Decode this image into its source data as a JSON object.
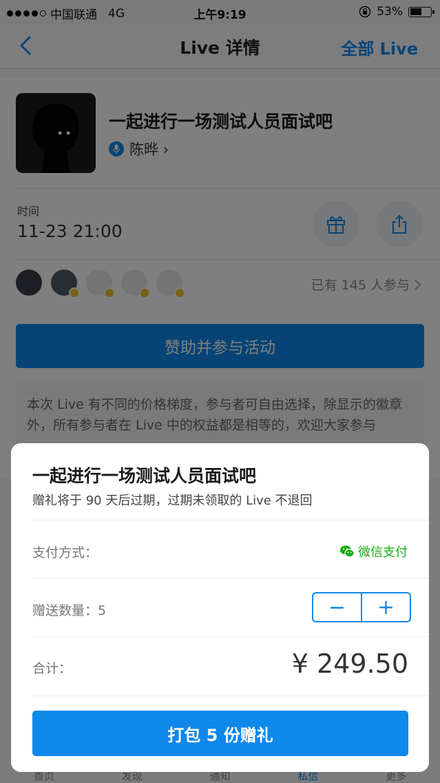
{
  "status_bar": {
    "carrier": "中国联通",
    "network": "4G",
    "time": "上午9:19",
    "battery": "53%"
  },
  "nav": {
    "title": "Live 详情",
    "right_link": "全部 Live",
    "back_icon": "chevron-left-icon"
  },
  "live": {
    "title": "一起进行一场测试人员面试吧",
    "speaker": "陈晔 ›",
    "time_label": "时间",
    "time_value": "11-23 21:00",
    "participants": "已有 145 人参与",
    "sponsor_button": "赞助并参与活动",
    "note": "本次 Live 有不同的价格梯度，参与者可自由选择，除显示的徽章外，所有参与者在 Live 中的权益都是相等的，欢迎大家参与"
  },
  "tabbar": {
    "items": [
      "首页",
      "发现",
      "通知",
      "私信",
      "更多"
    ]
  },
  "gift_modal": {
    "title": "一起进行一场测试人员面试吧",
    "subtitle": "赠礼将于 90 天后过期，过期未领取的 Live 不退回",
    "payment_label": "支付方式：",
    "payment_method": "微信支付",
    "quantity_label": "赠送数量：5",
    "minus": "−",
    "plus": "+",
    "total_label": "合计：",
    "total_value": "¥ 249.50",
    "pack_button": "打包 5 份赠礼"
  },
  "colors": {
    "accent": "#0f88eb",
    "wechat_green": "#1aad19"
  }
}
